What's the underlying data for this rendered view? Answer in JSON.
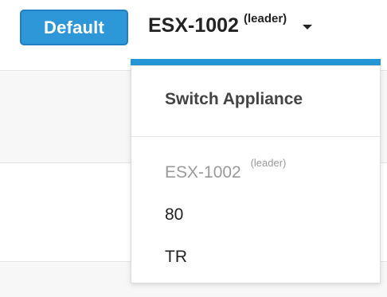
{
  "badge": {
    "label": "Default",
    "color": "#2e97d8"
  },
  "selector": {
    "current": "ESX-1002",
    "current_suffix": "(leader)",
    "accent_color": "#2496d6"
  },
  "dropdown": {
    "header": "Switch Appliance",
    "items": [
      {
        "label": "ESX-1002",
        "suffix": "(leader)",
        "disabled": true
      },
      {
        "label": "80",
        "suffix": "",
        "disabled": false
      },
      {
        "label": "TR",
        "suffix": "",
        "disabled": false
      }
    ]
  }
}
